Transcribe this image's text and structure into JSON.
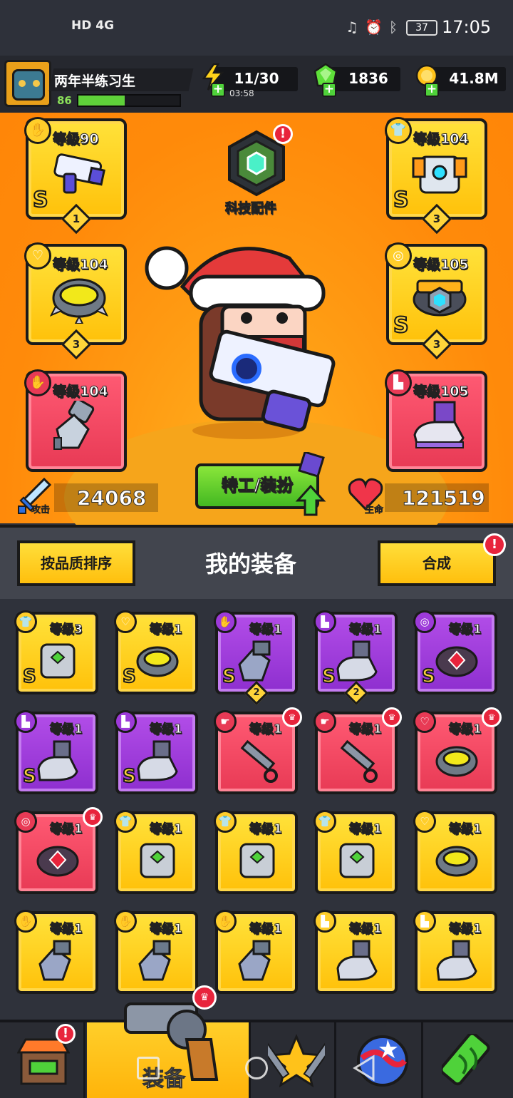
{
  "status_bar": {
    "left_text": "HD 4G",
    "battery": "37",
    "time": "17:05"
  },
  "player": {
    "name": "两年半练习生",
    "level": "86",
    "xp_fraction": 0.46
  },
  "resources": {
    "energy": {
      "value": "11/30",
      "timer": "03:58"
    },
    "gems": {
      "value": "1836"
    },
    "coins": {
      "value": "41.8M"
    }
  },
  "tech": {
    "label": "科技配件",
    "alert": "!"
  },
  "equipped": {
    "weapon": {
      "level": "等级90",
      "grade": "S",
      "stars": "1"
    },
    "armor": {
      "level": "等级104",
      "grade": "S",
      "stars": "3"
    },
    "necklace": {
      "level": "等级104",
      "stars": "3"
    },
    "belt": {
      "level": "等级105",
      "grade": "S",
      "stars": "3"
    },
    "gloves": {
      "level": "等级104"
    },
    "boots": {
      "level": "等级105"
    }
  },
  "stats": {
    "attack_label": "攻击",
    "attack": "24068",
    "hp_label": "生命",
    "hp": "121519"
  },
  "agent_button": "特工/装扮",
  "equipment_section": {
    "sort_button": "按品质排序",
    "title": "我的装备",
    "merge_button": "合成",
    "merge_alert": "!"
  },
  "grid_items": [
    {
      "level": "等级3",
      "color": "gold",
      "cat": "armor",
      "grade": "S"
    },
    {
      "level": "等级1",
      "color": "gold",
      "cat": "necklace",
      "grade": "S"
    },
    {
      "level": "等级1",
      "color": "purple",
      "cat": "gloves",
      "grade": "S",
      "stars": "2"
    },
    {
      "level": "等级1",
      "color": "purple",
      "cat": "boots",
      "grade": "S",
      "stars": "2"
    },
    {
      "level": "等级1",
      "color": "purple",
      "cat": "belt",
      "grade": "S"
    },
    {
      "level": "等级1",
      "color": "purple",
      "cat": "boots",
      "grade": "S"
    },
    {
      "level": "等级1",
      "color": "purple",
      "cat": "boots",
      "grade": "S"
    },
    {
      "level": "等级1",
      "color": "red",
      "cat": "weapon",
      "crown": true
    },
    {
      "level": "等级1",
      "color": "red",
      "cat": "weapon",
      "crown": true
    },
    {
      "level": "等级1",
      "color": "red",
      "cat": "necklace",
      "crown": true
    },
    {
      "level": "等级1",
      "color": "red",
      "cat": "belt",
      "crown": true
    },
    {
      "level": "等级1",
      "color": "gold",
      "cat": "armor"
    },
    {
      "level": "等级1",
      "color": "gold",
      "cat": "armor"
    },
    {
      "level": "等级1",
      "color": "gold",
      "cat": "armor"
    },
    {
      "level": "等级1",
      "color": "gold",
      "cat": "necklace"
    },
    {
      "level": "等级1",
      "color": "gold",
      "cat": "gloves"
    },
    {
      "level": "等级1",
      "color": "gold",
      "cat": "gloves"
    },
    {
      "level": "等级1",
      "color": "gold",
      "cat": "gloves"
    },
    {
      "level": "等级1",
      "color": "gold",
      "cat": "boots"
    },
    {
      "level": "等级1",
      "color": "gold",
      "cat": "boots"
    }
  ],
  "nav": {
    "active_label": "装备",
    "shop_alert": "!"
  },
  "colors": {
    "hero_bg": "#ff8a0a",
    "gold_card": "#ffc10a",
    "red_card": "#e83a55",
    "purple_card": "#8e2fcf",
    "green_button": "#43b822"
  }
}
